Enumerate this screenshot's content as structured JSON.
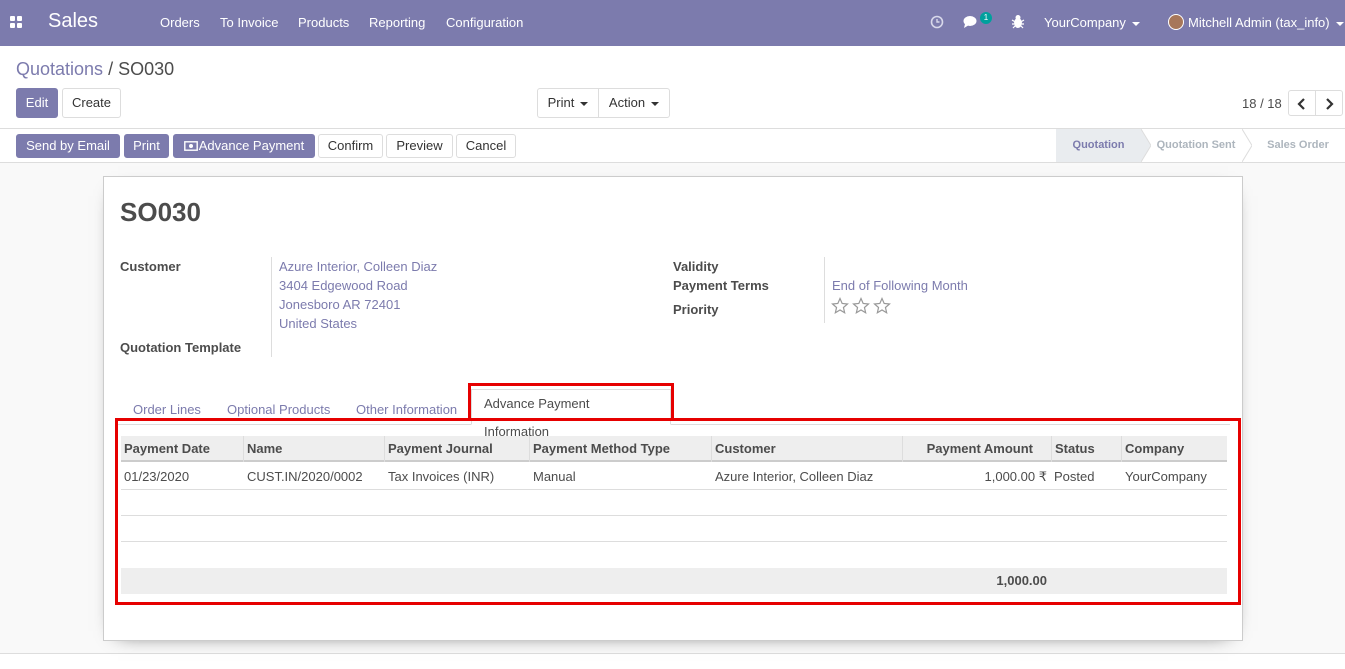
{
  "navbar": {
    "app_name": "Sales",
    "menu": [
      "Orders",
      "To Invoice",
      "Products",
      "Reporting",
      "Configuration"
    ],
    "chat_count": "1",
    "company": "YourCompany",
    "user": "Mitchell Admin (tax_info)"
  },
  "breadcrumb": {
    "parent": "Quotations",
    "separator": " / ",
    "current": "SO030"
  },
  "control": {
    "edit": "Edit",
    "create": "Create",
    "print": "Print",
    "action": "Action",
    "pager": "18 / 18"
  },
  "header_buttons": {
    "send_email": "Send by Email",
    "print": "Print",
    "advance_payment": "Advance Payment",
    "confirm": "Confirm",
    "preview": "Preview",
    "cancel": "Cancel"
  },
  "stages": [
    "Quotation",
    "Quotation Sent",
    "Sales Order"
  ],
  "form": {
    "title": "SO030",
    "customer_label": "Customer",
    "customer_lines": [
      "Azure Interior, Colleen Diaz",
      "3404 Edgewood Road",
      "Jonesboro AR 72401",
      "United States"
    ],
    "template_label": "Quotation Template",
    "validity_label": "Validity",
    "payment_terms_label": "Payment Terms",
    "payment_terms_value": "End of Following Month",
    "priority_label": "Priority",
    "priority_stars": 0
  },
  "tabs": [
    "Order Lines",
    "Optional Products",
    "Other Information",
    "Advance Payment Information"
  ],
  "payments": {
    "columns": [
      "Payment Date",
      "Name",
      "Payment Journal",
      "Payment Method Type",
      "Customer",
      "Payment Amount",
      "Status",
      "Company"
    ],
    "rows": [
      [
        "01/23/2020",
        "CUST.IN/2020/0002",
        "Tax Invoices (INR)",
        "Manual",
        "Azure Interior, Colleen Diaz",
        "1,000.00 ₹",
        "Posted",
        "YourCompany"
      ]
    ],
    "total": "1,000.00"
  },
  "colors": {
    "brand": "#7c7bad",
    "highlight": "#e60000"
  }
}
